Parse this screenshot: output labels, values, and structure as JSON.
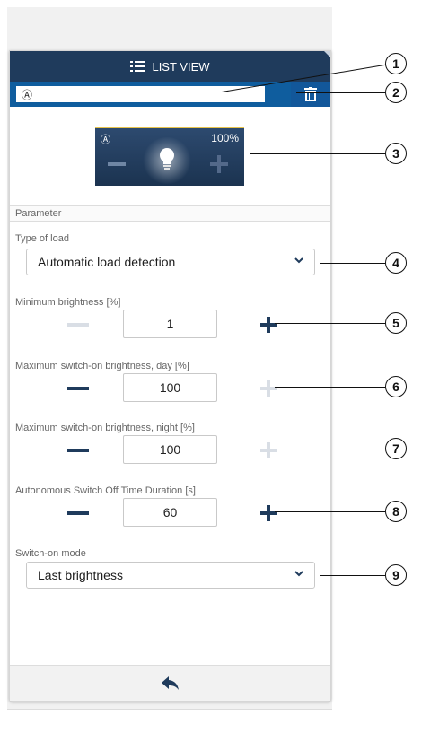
{
  "header": {
    "title": "LIST VIEW"
  },
  "name_field": {
    "value": "Ⓐ"
  },
  "tile": {
    "mode_symbol": "Ⓐ",
    "brightness": "100%"
  },
  "section": {
    "title": "Parameter"
  },
  "type_of_load": {
    "label": "Type of load",
    "value": "Automatic load detection"
  },
  "min_brightness": {
    "label": "Minimum brightness [%]",
    "value": "1"
  },
  "max_day": {
    "label": "Maximum switch-on brightness, day [%]",
    "value": "100"
  },
  "max_night": {
    "label": "Maximum switch-on brightness, night [%]",
    "value": "100"
  },
  "off_time": {
    "label": "Autonomous Switch Off Time Duration [s]",
    "value": "60"
  },
  "switch_on_mode": {
    "label": "Switch-on mode",
    "value": "Last brightness"
  },
  "icons": {
    "header": "list-icon",
    "delete": "trash-icon",
    "back": "back-arrow-icon",
    "bulb": "bulb-icon",
    "dropdown": "chevron-down-icon"
  },
  "callouts": [
    "1",
    "2",
    "3",
    "4",
    "5",
    "6",
    "7",
    "8",
    "9"
  ],
  "colors": {
    "header": "#1f3b5c",
    "name_bar": "#0f5d9e",
    "tile_border": "#e6c24a",
    "disabled": "#d9dee5"
  }
}
